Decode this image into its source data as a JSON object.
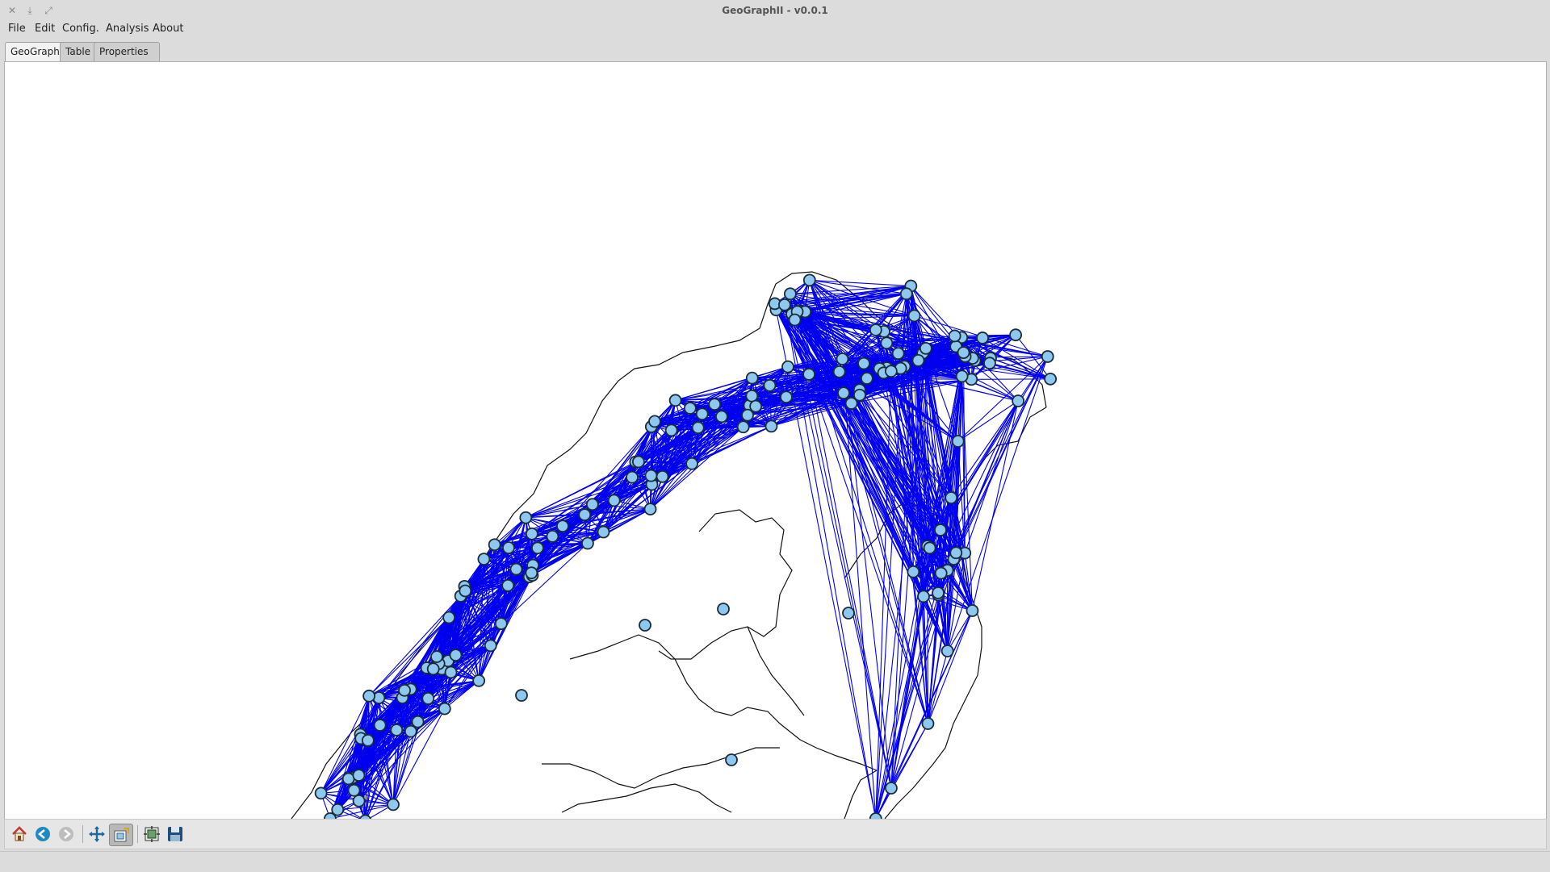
{
  "window": {
    "title": "GeoGraphII - v0.0.1",
    "controls": [
      "close-icon",
      "minimize-icon",
      "maximize-icon"
    ]
  },
  "menu": {
    "items": [
      "File",
      "Edit",
      "Config.",
      "Analysis",
      "About"
    ]
  },
  "tabs": {
    "items": [
      "GeoGraph",
      "Table",
      "Properties"
    ],
    "active": "GeoGraph"
  },
  "toolbar": {
    "buttons": [
      "home-icon",
      "back-icon",
      "forward-icon",
      "pan-icon",
      "zoom-icon",
      "configure-subplots-icon",
      "save-icon"
    ],
    "active": "zoom-icon",
    "disabled": [
      "forward-icon"
    ]
  },
  "graph": {
    "node_fill": "#8ec8ee",
    "node_stroke": "#1a2b3a",
    "edge_color": "#0000ee",
    "map_outline_color": "#111111"
  }
}
